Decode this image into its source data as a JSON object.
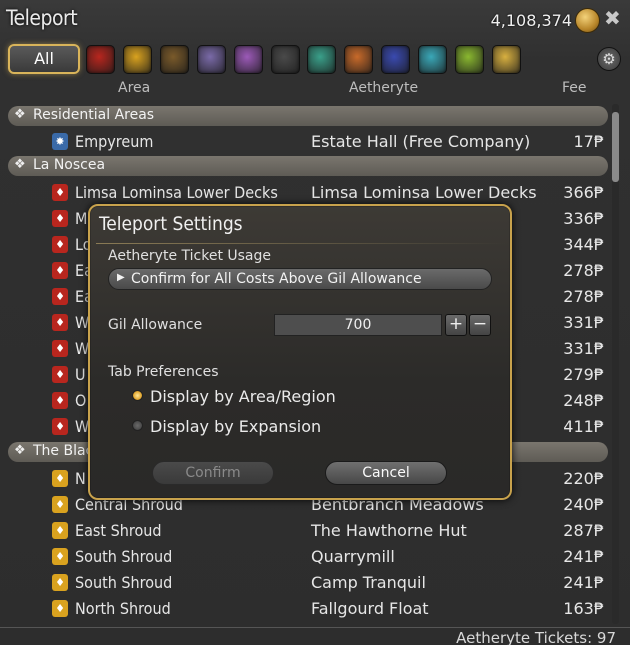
{
  "window": {
    "title": "Teleport",
    "top_deco_text": "...",
    "gil": "4,108,374",
    "close_icon": "crossed-swords-close-icon"
  },
  "tabs": {
    "all_label": "All",
    "region_tabs": [
      {
        "id": "la-noscea",
        "icon": "red-crest-icon",
        "color": "#b8261e"
      },
      {
        "id": "black-shroud",
        "icon": "yellow-crest-icon",
        "color": "#d9a21f"
      },
      {
        "id": "thanalan",
        "icon": "scales-icon",
        "color": "#7a5a2a"
      },
      {
        "id": "coerthas",
        "icon": "tower-icon",
        "color": "#7a6aa8"
      },
      {
        "id": "mor-dhona",
        "icon": "purple-wyrm-icon",
        "color": "#9c5ab8"
      },
      {
        "id": "abalathia",
        "icon": "swirl-icon",
        "color": "#4a4a4a"
      },
      {
        "id": "dravania",
        "icon": "dragon-icon",
        "color": "#3aa08a"
      },
      {
        "id": "gyr-abania",
        "icon": "orange-crest-icon",
        "color": "#c86a2a"
      },
      {
        "id": "othard",
        "icon": "blue-sigil-icon",
        "color": "#3a4ab0"
      },
      {
        "id": "norvrandt",
        "icon": "crystal-icon",
        "color": "#3aa8b8"
      },
      {
        "id": "housing",
        "icon": "green-leaf-icon",
        "color": "#8ab830"
      },
      {
        "id": "favorites",
        "icon": "star-icon",
        "color": "#d8b040"
      }
    ],
    "settings_icon": "gear-icon"
  },
  "columns": {
    "area": "Area",
    "aetheryte": "Aetheryte",
    "fee": "Fee"
  },
  "groups": [
    {
      "name": "Residential Areas"
    },
    {
      "name": "La Noscea"
    },
    {
      "name": "The Blac"
    }
  ],
  "rows": [
    {
      "area": "Empyreum",
      "aetheryte": "Estate Hall (Free Company)",
      "fee": "17₱",
      "icon_color": "#3a6aa8",
      "icon_glyph": "✸"
    },
    {
      "area": "Limsa Lominsa Lower Decks",
      "aetheryte": "Limsa Lominsa Lower Decks",
      "fee": "366₱",
      "icon_color": "#b8261e",
      "icon_glyph": "♦"
    },
    {
      "area": "M",
      "aetheryte": "",
      "fee": "336₱",
      "icon_color": "#b8261e",
      "icon_glyph": "♦"
    },
    {
      "area": "Lo",
      "aetheryte": "",
      "fee": "344₱",
      "icon_color": "#b8261e",
      "icon_glyph": "♦"
    },
    {
      "area": "Ea",
      "aetheryte": "",
      "fee": "278₱",
      "icon_color": "#b8261e",
      "icon_glyph": "♦"
    },
    {
      "area": "Ea",
      "aetheryte": "",
      "fee": "278₱",
      "icon_color": "#b8261e",
      "icon_glyph": "♦"
    },
    {
      "area": "W",
      "aetheryte": "",
      "fee": "331₱",
      "icon_color": "#b8261e",
      "icon_glyph": "♦"
    },
    {
      "area": "W",
      "aetheryte": "",
      "fee": "331₱",
      "icon_color": "#b8261e",
      "icon_glyph": "♦"
    },
    {
      "area": "U",
      "aetheryte": "",
      "fee": "279₱",
      "icon_color": "#b8261e",
      "icon_glyph": "♦"
    },
    {
      "area": "O",
      "aetheryte": "",
      "fee": "248₱",
      "icon_color": "#b8261e",
      "icon_glyph": "♦"
    },
    {
      "area": "W",
      "aetheryte": "",
      "fee": "411₱",
      "icon_color": "#b8261e",
      "icon_glyph": "♦"
    },
    {
      "area": "N",
      "aetheryte": "",
      "fee": "220₱",
      "icon_color": "#d9a21f",
      "icon_glyph": "♦"
    },
    {
      "area": "Central Shroud",
      "aetheryte": "Bentbranch Meadows",
      "fee": "240₱",
      "icon_color": "#d9a21f",
      "icon_glyph": "♦"
    },
    {
      "area": "East Shroud",
      "aetheryte": "The Hawthorne Hut",
      "fee": "287₱",
      "icon_color": "#d9a21f",
      "icon_glyph": "♦"
    },
    {
      "area": "South Shroud",
      "aetheryte": "Quarrymill",
      "fee": "241₱",
      "icon_color": "#d9a21f",
      "icon_glyph": "♦"
    },
    {
      "area": "South Shroud",
      "aetheryte": "Camp Tranquil",
      "fee": "241₱",
      "icon_color": "#d9a21f",
      "icon_glyph": "♦"
    },
    {
      "area": "North Shroud",
      "aetheryte": "Fallgourd Float",
      "fee": "163₱",
      "icon_color": "#d9a21f",
      "icon_glyph": "♦"
    }
  ],
  "footer": {
    "tickets": "Aetheryte Tickets: 97"
  },
  "modal": {
    "title": "Teleport Settings",
    "ticket_usage_label": "Aetheryte Ticket Usage",
    "ticket_usage_value": "Confirm for All Costs Above Gil Allowance",
    "gil_allowance_label": "Gil Allowance",
    "gil_allowance_value": "700",
    "plus": "+",
    "minus": "−",
    "tab_pref_label": "Tab Preferences",
    "radio_area": "Display by Area/Region",
    "radio_expansion": "Display by Expansion",
    "selected_pref": "area",
    "confirm": "Confirm",
    "cancel": "Cancel"
  }
}
